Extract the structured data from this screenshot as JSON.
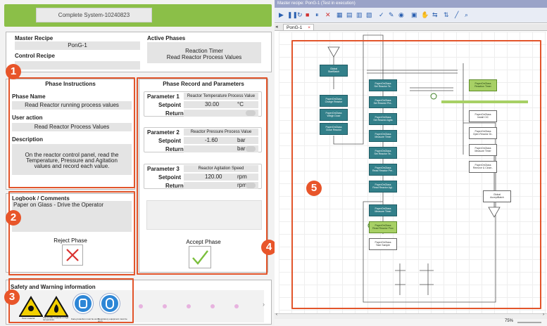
{
  "window": {
    "title": "Complete System-10240823"
  },
  "recipe": {
    "master_label": "Master Recipe",
    "master_value": "PonG-1",
    "control_label": "Control Recipe",
    "control_value": "",
    "active_label": "Active Phases",
    "active_line1": "Reaction Timer",
    "active_line2": "Read Reactor Process Values"
  },
  "instructions": {
    "title": "Phase Instructions",
    "name_label": "Phase Name",
    "name_value": "Read Reactor running process values",
    "action_label": "User action",
    "action_value": "Read Reactor Process Values",
    "desc_label": "Description",
    "desc_value": "On the reactor control panel, read the Temperature, Pressure and Agitation values and record each value."
  },
  "logbook": {
    "title": "Logbook / Comments",
    "text": "Paper on Glass - Drive the Operator"
  },
  "reject": {
    "label": "Reject Phase"
  },
  "record": {
    "title": "Phase Record and Parameters",
    "accept_label": "Accept Phase"
  },
  "params": [
    {
      "label": "Parameter 1",
      "name": "Reactor Temperature Process Value",
      "setpoint_label": "Setpoint",
      "setpoint": "30.00",
      "unit": "°C",
      "return_label": "Return",
      "return_unit": ""
    },
    {
      "label": "Parameter 2",
      "name": "Reactor Pressure Process Value",
      "setpoint_label": "Setpoint",
      "setpoint": "-1.60",
      "unit": "bar",
      "return_label": "Return",
      "return_unit": "bar"
    },
    {
      "label": "Parameter 3",
      "name": "Reactor Agitation Speed",
      "setpoint_label": "Setpoint",
      "setpoint": "120.00",
      "unit": "rpm",
      "return_label": "Return",
      "return_unit": "rpm"
    }
  ],
  "safety": {
    "title": "Safety and Warning information",
    "icons": [
      {
        "name": "toxic-material-icon",
        "caption": "Toxic material"
      },
      {
        "name": "flammable-icon",
        "caption": "Flammable material or high temperature"
      },
      {
        "name": "face-protection-icon",
        "caption": "Face protection must be worn"
      },
      {
        "name": "respiratory-icon",
        "caption": "Respiratory equipment must be worn"
      }
    ]
  },
  "callouts": [
    "1",
    "2",
    "3",
    "4",
    "5"
  ],
  "editor": {
    "title": "Master recipe: PonG-1 (Test in execution)",
    "tab": "PonG-1",
    "tab_close": "×",
    "zoom": "75%"
  },
  "nodes": {
    "global_start": "Global\nStartBatch",
    "chg_a": "PaperOnGlass\nCharge Reactor",
    "weigh": "PaperOnGlass\nWeigh Dose",
    "close": "PaperOnGlass\nClose Reactor",
    "set_temp": "PaperOnGlass\nSet Reactor Te..",
    "set_press": "PaperOnGlass\nSet Reactor Pre..",
    "set_agit": "PaperOnGlass\nSet Reactor Agita",
    "meas": "PaperOnGlass\nMeasure Timer",
    "set_te2": "PaperOnGlass\nSet Reactor Te..",
    "read_pre": "PaperOnGlass\nRead Reactor Pre..",
    "read_agi": "PaperOnGlass\nRead Reactor Agi..",
    "meas2": "PaperOnGlass\nMeasure Timer",
    "read_pv": "PaperOnGlass\nRead Reactor Proc",
    "take": "PaperOnGlass\nTake Sample",
    "react_timer": "PaperOnGlass\nReaction Timer",
    "install": "PaperOnGlass\nInstall CIC",
    "open": "PaperOnGlass\nOpen Reactor Dr..",
    "meas3": "PaperOnGlass\nMeasure Timer",
    "remove": "PaperOnGlass\nRemove & Close..",
    "global_end": "Global\nAcceptBatch"
  }
}
